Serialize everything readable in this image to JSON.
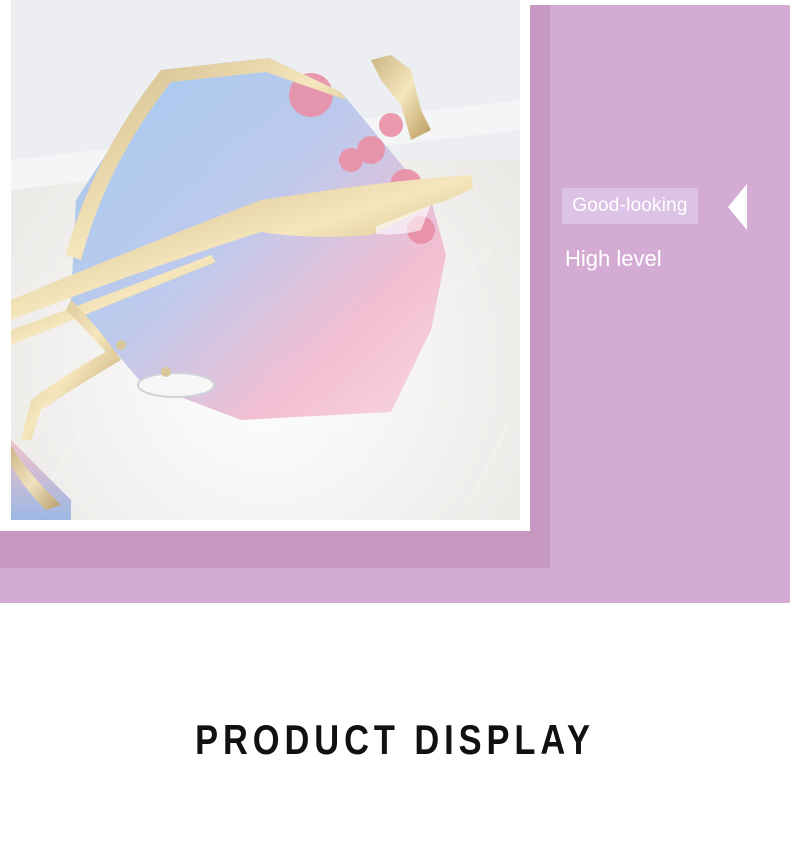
{
  "product_badge": {
    "label": "Good-looking",
    "arrow_icon": "triangle-left-icon"
  },
  "product_subtitle": "High level",
  "section": {
    "title": "PRODUCT DISPLAY"
  },
  "colors": {
    "outer_band": "#d4acd3",
    "inner_band": "#c799c2",
    "badge_bg": "#dcc2e4",
    "title_text": "#111111"
  }
}
